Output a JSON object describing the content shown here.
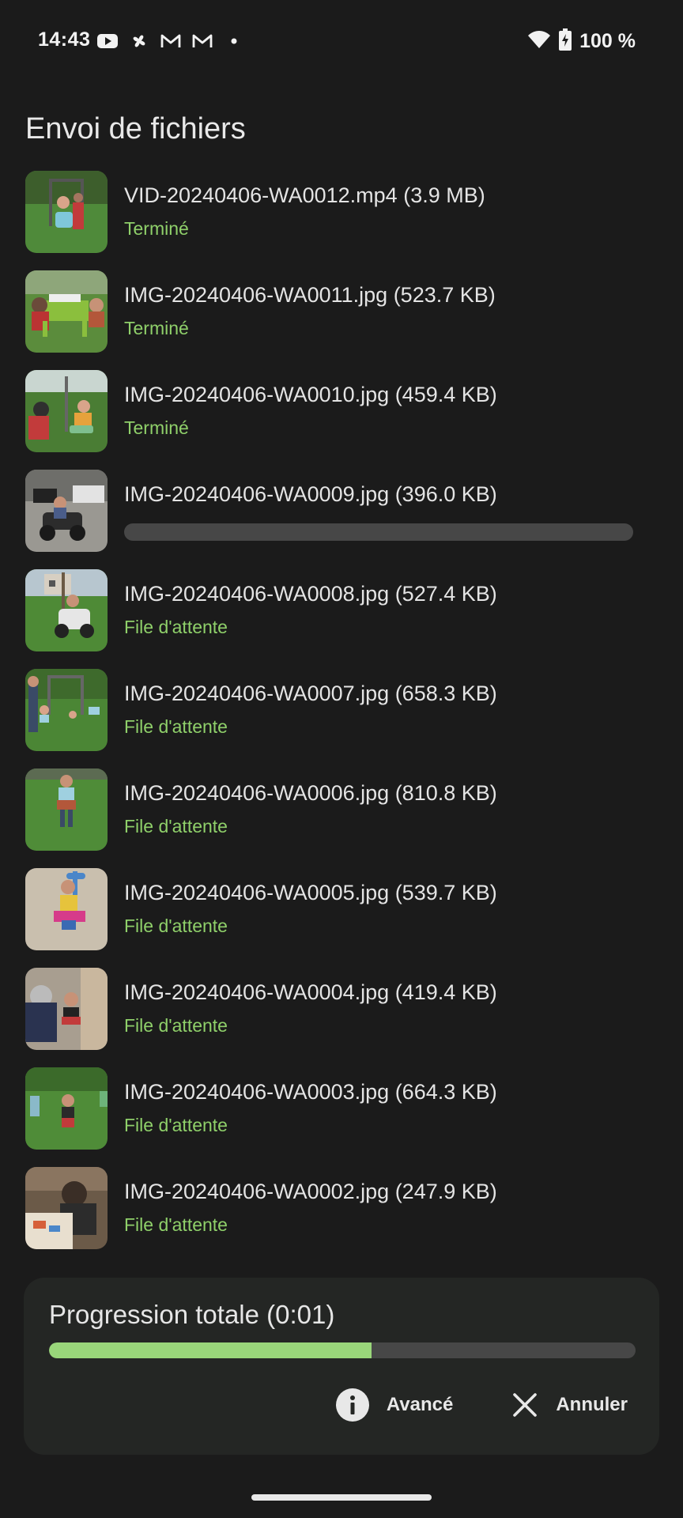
{
  "status_bar": {
    "time": "14:43",
    "icons_left": [
      "youtube-icon",
      "pinwheel-icon",
      "gmail-icon",
      "gmail-icon",
      "dot-icon"
    ],
    "icons_right": [
      "wifi-icon",
      "battery-charging-icon"
    ],
    "battery": "100 %"
  },
  "title": "Envoi de fichiers",
  "colors": {
    "background": "#1b1b1b",
    "accent": "#8fd06a",
    "card": "#242624",
    "track": "#474747"
  },
  "files": [
    {
      "name": "VID-20240406-WA0012.mp4 (3.9 MB)",
      "status": "Terminé",
      "progress": null
    },
    {
      "name": "IMG-20240406-WA0011.jpg (523.7 KB)",
      "status": "Terminé",
      "progress": null
    },
    {
      "name": "IMG-20240406-WA0010.jpg (459.4 KB)",
      "status": "Terminé",
      "progress": null
    },
    {
      "name": "IMG-20240406-WA0009.jpg (396.0 KB)",
      "status": "",
      "progress": 0
    },
    {
      "name": "IMG-20240406-WA0008.jpg (527.4 KB)",
      "status": "File d'attente",
      "progress": null
    },
    {
      "name": "IMG-20240406-WA0007.jpg (658.3 KB)",
      "status": "File d'attente",
      "progress": null
    },
    {
      "name": "IMG-20240406-WA0006.jpg (810.8 KB)",
      "status": "File d'attente",
      "progress": null
    },
    {
      "name": "IMG-20240406-WA0005.jpg (539.7 KB)",
      "status": "File d'attente",
      "progress": null
    },
    {
      "name": "IMG-20240406-WA0004.jpg (419.4 KB)",
      "status": "File d'attente",
      "progress": null
    },
    {
      "name": "IMG-20240406-WA0003.jpg (664.3 KB)",
      "status": "File d'attente",
      "progress": null
    },
    {
      "name": "IMG-20240406-WA0002.jpg (247.9 KB)",
      "status": "File d'attente",
      "progress": null
    }
  ],
  "total": {
    "label": "Progression totale (0:01)",
    "progress": 0.55
  },
  "actions": {
    "advanced_label": "Avancé",
    "cancel_label": "Annuler"
  }
}
